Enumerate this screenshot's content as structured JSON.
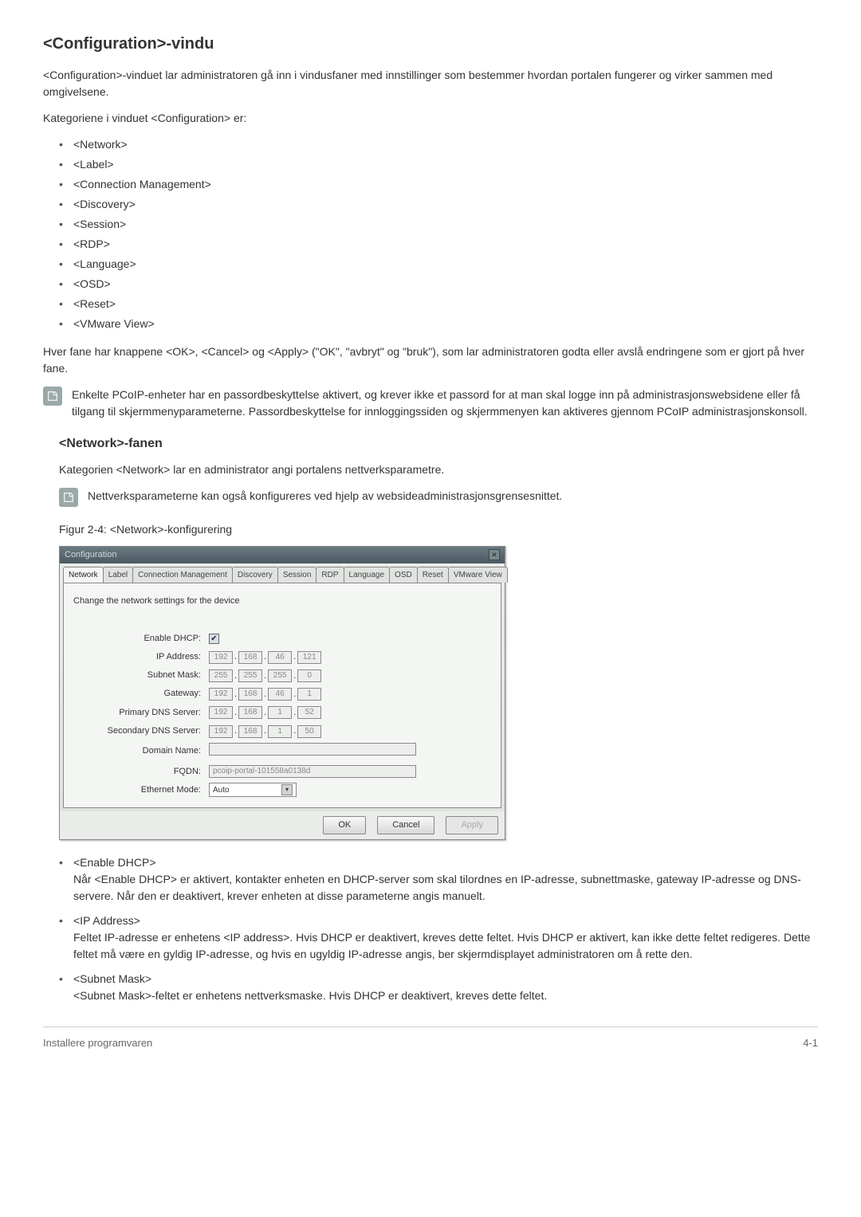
{
  "h1": "<Configuration>-vindu",
  "intro": "<Configuration>-vinduet lar administratoren gå inn i vindusfaner med innstillinger som bestemmer hvordan portalen fungerer og virker sammen med omgivelsene.",
  "categoriesLabel": "Kategoriene i vinduet <Configuration> er:",
  "categories": [
    "<Network>",
    "<Label>",
    "<Connection Management>",
    "<Discovery>",
    "<Session>",
    "<RDP>",
    "<Language>",
    "<OSD>",
    "<Reset>",
    "<VMware View>"
  ],
  "buttonsNote": "Hver fane har knappene <OK>, <Cancel> og <Apply> (\"OK\", \"avbryt\" og \"bruk\"), som lar administratoren godta eller avslå endringene som er gjort på hver fane.",
  "note1": "Enkelte PCoIP-enheter har en passordbeskyttelse aktivert, og krever ikke et passord for at man skal logge inn på administrasjonswebsidene eller få tilgang til skjermmenyparameterne. Passordbeskyttelse for innloggingssiden og skjermmenyen kan aktiveres gjennom PCoIP administrasjonskonsoll.",
  "h2": "<Network>-fanen",
  "networkIntro": "Kategorien <Network> lar en administrator angi portalens nettverksparametre.",
  "note2": "Nettverksparameterne kan også konfigureres ved hjelp av websideadministrasjonsgrensesnittet.",
  "figureCaption": "Figur 2-4: <Network>-konfigurering",
  "window": {
    "title": "Configuration",
    "tabs": [
      "Network",
      "Label",
      "Connection Management",
      "Discovery",
      "Session",
      "RDP",
      "Language",
      "OSD",
      "Reset",
      "VMware View"
    ],
    "activeTabIndex": 0,
    "desc": "Change the network settings for the device",
    "fields": {
      "enableDhcp": {
        "label": "Enable DHCP:",
        "checked": true
      },
      "ipAddress": {
        "label": "IP Address:",
        "v": [
          "192",
          "168",
          "46",
          "121"
        ]
      },
      "subnetMask": {
        "label": "Subnet Mask:",
        "v": [
          "255",
          "255",
          "255",
          "0"
        ]
      },
      "gateway": {
        "label": "Gateway:",
        "v": [
          "192",
          "168",
          "46",
          "1"
        ]
      },
      "primaryDns": {
        "label": "Primary DNS Server:",
        "v": [
          "192",
          "168",
          "1",
          "52"
        ]
      },
      "secondaryDns": {
        "label": "Secondary DNS Server:",
        "v": [
          "192",
          "168",
          "1",
          "50"
        ]
      },
      "domainName": {
        "label": "Domain Name:",
        "value": ""
      },
      "fqdn": {
        "label": "FQDN:",
        "value": "pcoip-portal-101558a0138d"
      },
      "ethernetMode": {
        "label": "Ethernet Mode:",
        "value": "Auto"
      }
    },
    "buttons": {
      "ok": "OK",
      "cancel": "Cancel",
      "apply": "Apply"
    }
  },
  "desc": [
    {
      "title": "<Enable DHCP>",
      "text": "Når <Enable DHCP> er aktivert, kontakter enheten en DHCP-server som skal tilordnes en IP-adresse, subnettmaske, gateway IP-adresse og DNS-servere. Når den er deaktivert, krever enheten at disse parameterne angis manuelt."
    },
    {
      "title": "<IP Address>",
      "text": "Feltet IP-adresse er enhetens <IP address>. Hvis DHCP er deaktivert, kreves dette feltet. Hvis DHCP er aktivert, kan ikke dette feltet redigeres. Dette feltet må være en gyldig IP-adresse, og hvis en ugyldig IP-adresse angis, ber skjermdisplayet administratoren om å rette den."
    },
    {
      "title": "<Subnet Mask>",
      "text": "<Subnet Mask>-feltet er enhetens nettverksmaske. Hvis DHCP er deaktivert, kreves dette feltet."
    }
  ],
  "footer": {
    "left": "Installere programvaren",
    "right": "4-1"
  }
}
